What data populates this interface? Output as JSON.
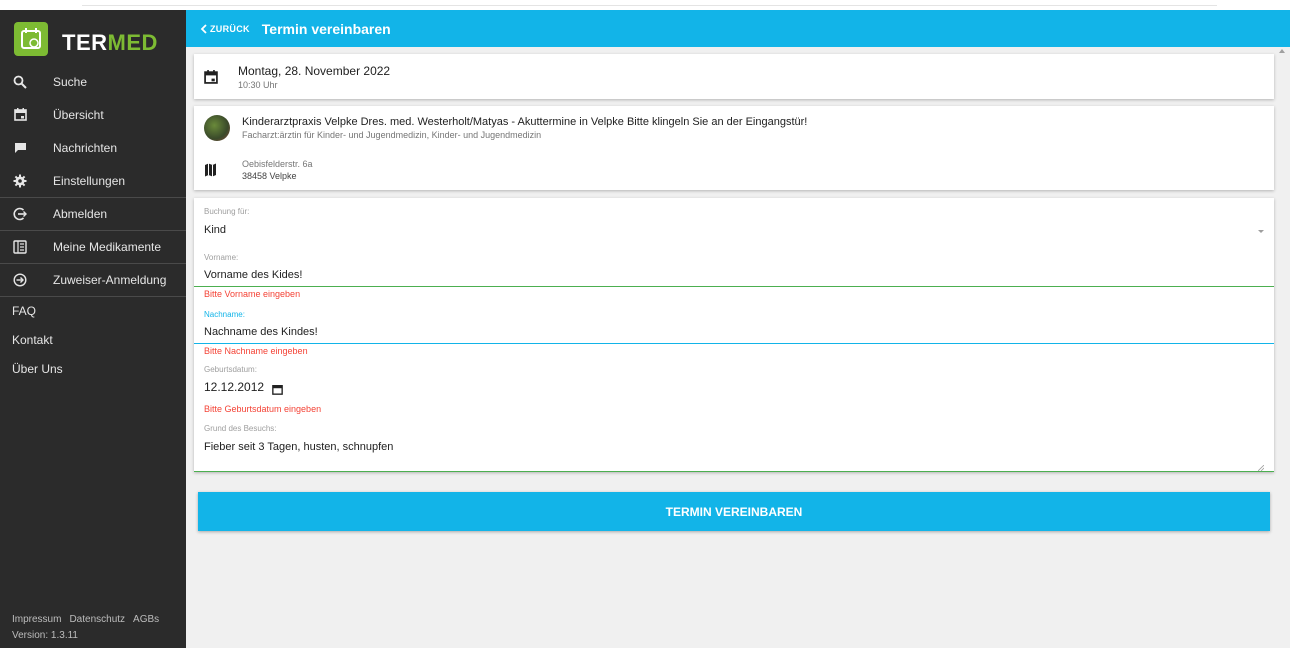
{
  "app": {
    "logo_part1": "TER",
    "logo_part2": "MED"
  },
  "sidebar": {
    "items": [
      {
        "label": "Suche",
        "icon": "search-icon"
      },
      {
        "label": "Übersicht",
        "icon": "calendar-icon"
      },
      {
        "label": "Nachrichten",
        "icon": "chat-icon"
      },
      {
        "label": "Einstellungen",
        "icon": "gear-icon"
      },
      {
        "label": "Abmelden",
        "icon": "logout-icon"
      },
      {
        "label": "Meine Medikamente",
        "icon": "medication-icon"
      },
      {
        "label": "Zuweiser-Anmeldung",
        "icon": "login-icon"
      },
      {
        "label": "FAQ"
      },
      {
        "label": "Kontakt"
      },
      {
        "label": "Über Uns"
      }
    ],
    "footer_links": [
      "Impressum",
      "Datenschutz",
      "AGBs"
    ],
    "version": "Version: 1.3.11"
  },
  "header": {
    "back_label": "ZURÜCK",
    "title": "Termin vereinbaren"
  },
  "appointment": {
    "date": "Montag, 28. November 2022",
    "time": "10:30 Uhr"
  },
  "practice": {
    "name": "Kinderarztpraxis Velpke Dres. med. Westerholt/Matyas - Akuttermine in Velpke Bitte klingeln Sie an der Eingangstür!",
    "specialty": "Facharzt:ärztin für Kinder- und Jugendmedizin, Kinder- und Jugendmedizin",
    "street": "Oebisfelderstr. 6a",
    "city": "38458 Velpke"
  },
  "form": {
    "booking_for_label": "Buchung für:",
    "booking_for_value": "Kind",
    "firstname_label": "Vorname:",
    "firstname_value": "Vorname des Kides!",
    "firstname_error": "Bitte Vorname eingeben",
    "lastname_label": "Nachname:",
    "lastname_value": "Nachname des Kindes!",
    "lastname_error": "Bitte Nachname eingeben",
    "birthdate_label": "Geburtsdatum:",
    "birthdate_value": "12.12.2012",
    "birthdate_error": "Bitte Geburtsdatum eingeben",
    "reason_label": "Grund des Besuchs:",
    "reason_value": "Fieber seit 3 Tagen, husten, schnupfen"
  },
  "submit_label": "TERMIN VEREINBAREN",
  "colors": {
    "accent": "#12b4e8",
    "sidebar": "#2b2b2b",
    "logo_green": "#7dbb33",
    "error": "#f44336",
    "valid_line": "#4caf50"
  }
}
